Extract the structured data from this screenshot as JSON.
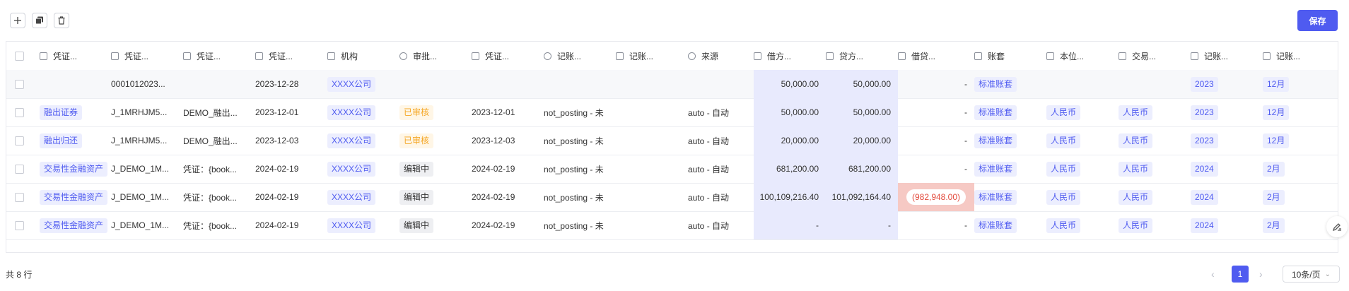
{
  "toolbar": {
    "add_icon": "plus-icon",
    "copy_icon": "copy-icon",
    "delete_icon": "trash-icon",
    "save_label": "保存"
  },
  "table": {
    "columns": [
      {
        "label": "凭证...",
        "icon": "search-list-icon"
      },
      {
        "label": "凭证...",
        "icon": "text-icon"
      },
      {
        "label": "凭证...",
        "icon": "text-icon"
      },
      {
        "label": "凭证...",
        "icon": "calendar-icon"
      },
      {
        "label": "机构",
        "icon": "search-list-icon"
      },
      {
        "label": "审批...",
        "icon": "radio-icon"
      },
      {
        "label": "凭证...",
        "icon": "calendar-icon"
      },
      {
        "label": "记账...",
        "icon": "radio-icon"
      },
      {
        "label": "记账...",
        "icon": "calendar-icon"
      },
      {
        "label": "来源",
        "icon": "radio-icon"
      },
      {
        "label": "借方...",
        "icon": "number-icon"
      },
      {
        "label": "贷方...",
        "icon": "number-icon"
      },
      {
        "label": "借贷...",
        "icon": "number-icon"
      },
      {
        "label": "账套",
        "icon": "search-list-icon"
      },
      {
        "label": "本位...",
        "icon": "search-list-icon"
      },
      {
        "label": "交易...",
        "icon": "search-list-icon"
      },
      {
        "label": "记账...",
        "icon": "search-list-icon"
      },
      {
        "label": "记账...",
        "icon": "search-list-icon"
      }
    ],
    "rows": [
      {
        "type": "",
        "no": "0001012023...",
        "desc": "",
        "date": "2023-12-28",
        "org": "XXXX公司",
        "approval": "",
        "vdate": "",
        "post": "",
        "pdate": "",
        "source": "",
        "debit": "50,000.00",
        "credit": "50,000.00",
        "diff": "-",
        "book": "标准账套",
        "base": "",
        "trade": "",
        "year": "2023",
        "month": "12月"
      },
      {
        "type": "融出证券",
        "no": "J_1MRHJM5...",
        "desc": "DEMO_融出...",
        "date": "2023-12-01",
        "org": "XXXX公司",
        "approval": "已审核",
        "vdate": "2023-12-01",
        "post": "not_posting - 未",
        "pdate": "",
        "source": "auto - 自动",
        "debit": "50,000.00",
        "credit": "50,000.00",
        "diff": "-",
        "book": "标准账套",
        "base": "人民币",
        "trade": "人民币",
        "year": "2023",
        "month": "12月"
      },
      {
        "type": "融出归还",
        "no": "J_1MRHJM5...",
        "desc": "DEMO_融出...",
        "date": "2023-12-03",
        "org": "XXXX公司",
        "approval": "已审核",
        "vdate": "2023-12-03",
        "post": "not_posting - 未",
        "pdate": "",
        "source": "auto - 自动",
        "debit": "20,000.00",
        "credit": "20,000.00",
        "diff": "-",
        "book": "标准账套",
        "base": "人民币",
        "trade": "人民币",
        "year": "2023",
        "month": "12月"
      },
      {
        "type": "交易性金融资产",
        "no": "J_DEMO_1M...",
        "desc": "凭证：{book...",
        "date": "2024-02-19",
        "org": "XXXX公司",
        "approval": "编辑中",
        "vdate": "2024-02-19",
        "post": "not_posting - 未",
        "pdate": "",
        "source": "auto - 自动",
        "debit": "681,200.00",
        "credit": "681,200.00",
        "diff": "-",
        "book": "标准账套",
        "base": "人民币",
        "trade": "人民币",
        "year": "2024",
        "month": "2月"
      },
      {
        "type": "交易性金融资产",
        "no": "J_DEMO_1M...",
        "desc": "凭证：{book...",
        "date": "2024-02-19",
        "org": "XXXX公司",
        "approval": "编辑中",
        "vdate": "2024-02-19",
        "post": "not_posting - 未",
        "pdate": "",
        "source": "auto - 自动",
        "debit": "100,109,216.40",
        "credit": "101,092,164.40",
        "diff": "(982,948.00)",
        "book": "标准账套",
        "base": "人民币",
        "trade": "人民币",
        "year": "2024",
        "month": "2月"
      },
      {
        "type": "交易性金融资产",
        "no": "J_DEMO_1M...",
        "desc": "凭证：{book...",
        "date": "2024-02-19",
        "org": "XXXX公司",
        "approval": "编辑中",
        "vdate": "2024-02-19",
        "post": "not_posting - 未",
        "pdate": "",
        "source": "auto - 自动",
        "debit": "-",
        "credit": "-",
        "diff": "-",
        "book": "标准账套",
        "base": "人民币",
        "trade": "人民币",
        "year": "2024",
        "month": "2月"
      }
    ]
  },
  "footer": {
    "total": "共 8 行",
    "current_page": "1",
    "page_size": "10条/页",
    "prev_icon": "chevron-left-icon",
    "next_icon": "chevron-right-icon"
  },
  "colors": {
    "accent": "#4f5bf0",
    "amount_highlight": "#e8eafd",
    "negative_bg": "#f6c9c4",
    "negative_text": "#e34b3d",
    "approved": "#f5a623"
  }
}
